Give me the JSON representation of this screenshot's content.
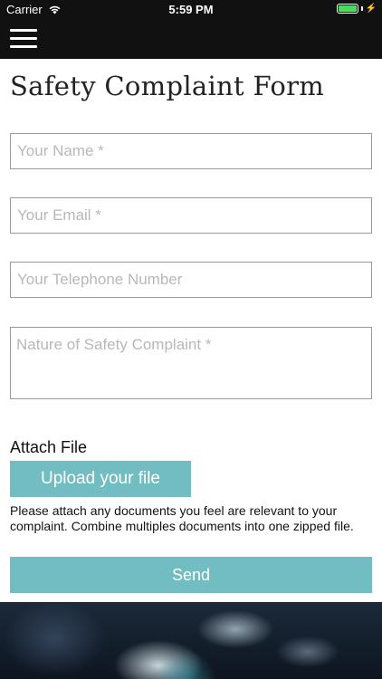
{
  "status_bar": {
    "carrier": "Carrier",
    "time": "5:59 PM",
    "battery_level": 1.0,
    "wifi_icon": "wifi-icon",
    "battery_icon": "battery-icon",
    "charging_icon": "charging-bolt-icon"
  },
  "nav": {
    "menu_icon": "hamburger-menu-icon",
    "background": "#111111"
  },
  "form": {
    "title": "Safety Complaint Form",
    "name_placeholder": "Your Name *",
    "name_value": "",
    "email_placeholder": "Your Email *",
    "email_value": "",
    "phone_placeholder": "Your Telephone Number",
    "phone_value": "",
    "complaint_placeholder": "Nature of Safety Complaint *",
    "complaint_value": "",
    "attach_label": "Attach File",
    "upload_label": "Upload your file",
    "help_text": "Please attach any documents you feel are relevant to your complaint. Combine multiples documents into one zipped file.",
    "send_label": "Send"
  },
  "colors": {
    "accent": "#72bdc2",
    "dark": "#111111",
    "border": "#9a9a9a",
    "battery": "#4cd964"
  }
}
